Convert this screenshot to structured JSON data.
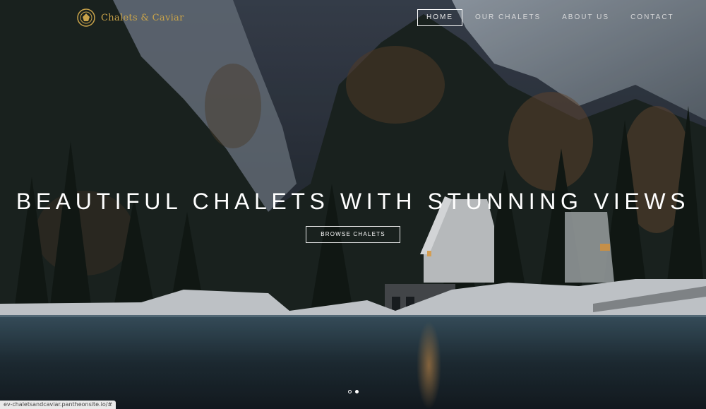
{
  "brand": {
    "name": "Chalets & Caviar",
    "logo_icon": "crest-logo-icon",
    "accent": "#c9a34a"
  },
  "nav": {
    "items": [
      {
        "label": "HOME",
        "active": true
      },
      {
        "label": "OUR CHALETS",
        "active": false
      },
      {
        "label": "ABOUT US",
        "active": false
      },
      {
        "label": "CONTACT",
        "active": false
      }
    ]
  },
  "hero": {
    "headline": "BEAUTIFUL CHALETS WITH STUNNING VIEWS",
    "cta_label": "BROWSE CHALETS",
    "slides": {
      "count": 2,
      "active_index": 2
    }
  },
  "status_bar": {
    "url": "ev-chaletsandcaviar.pantheonsite.io/#"
  }
}
